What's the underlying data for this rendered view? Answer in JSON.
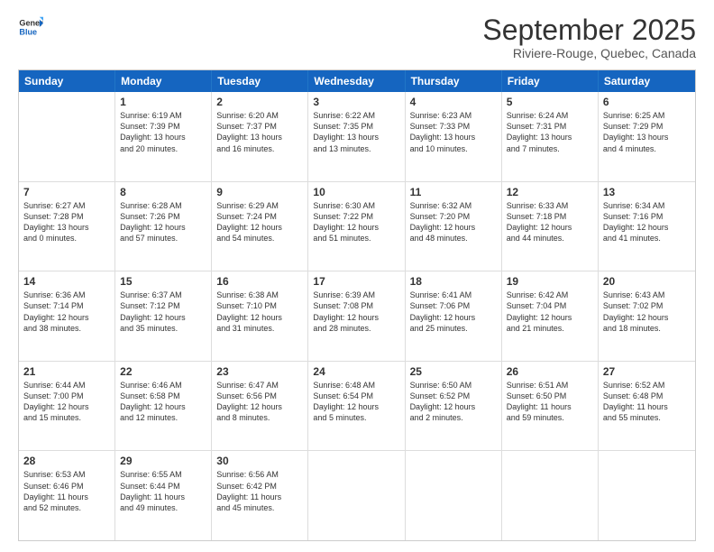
{
  "header": {
    "logo_general": "General",
    "logo_blue": "Blue",
    "month": "September 2025",
    "location": "Riviere-Rouge, Quebec, Canada"
  },
  "days_of_week": [
    "Sunday",
    "Monday",
    "Tuesday",
    "Wednesday",
    "Thursday",
    "Friday",
    "Saturday"
  ],
  "rows": [
    [
      {
        "day": "",
        "lines": []
      },
      {
        "day": "1",
        "lines": [
          "Sunrise: 6:19 AM",
          "Sunset: 7:39 PM",
          "Daylight: 13 hours",
          "and 20 minutes."
        ]
      },
      {
        "day": "2",
        "lines": [
          "Sunrise: 6:20 AM",
          "Sunset: 7:37 PM",
          "Daylight: 13 hours",
          "and 16 minutes."
        ]
      },
      {
        "day": "3",
        "lines": [
          "Sunrise: 6:22 AM",
          "Sunset: 7:35 PM",
          "Daylight: 13 hours",
          "and 13 minutes."
        ]
      },
      {
        "day": "4",
        "lines": [
          "Sunrise: 6:23 AM",
          "Sunset: 7:33 PM",
          "Daylight: 13 hours",
          "and 10 minutes."
        ]
      },
      {
        "day": "5",
        "lines": [
          "Sunrise: 6:24 AM",
          "Sunset: 7:31 PM",
          "Daylight: 13 hours",
          "and 7 minutes."
        ]
      },
      {
        "day": "6",
        "lines": [
          "Sunrise: 6:25 AM",
          "Sunset: 7:29 PM",
          "Daylight: 13 hours",
          "and 4 minutes."
        ]
      }
    ],
    [
      {
        "day": "7",
        "lines": [
          "Sunrise: 6:27 AM",
          "Sunset: 7:28 PM",
          "Daylight: 13 hours",
          "and 0 minutes."
        ]
      },
      {
        "day": "8",
        "lines": [
          "Sunrise: 6:28 AM",
          "Sunset: 7:26 PM",
          "Daylight: 12 hours",
          "and 57 minutes."
        ]
      },
      {
        "day": "9",
        "lines": [
          "Sunrise: 6:29 AM",
          "Sunset: 7:24 PM",
          "Daylight: 12 hours",
          "and 54 minutes."
        ]
      },
      {
        "day": "10",
        "lines": [
          "Sunrise: 6:30 AM",
          "Sunset: 7:22 PM",
          "Daylight: 12 hours",
          "and 51 minutes."
        ]
      },
      {
        "day": "11",
        "lines": [
          "Sunrise: 6:32 AM",
          "Sunset: 7:20 PM",
          "Daylight: 12 hours",
          "and 48 minutes."
        ]
      },
      {
        "day": "12",
        "lines": [
          "Sunrise: 6:33 AM",
          "Sunset: 7:18 PM",
          "Daylight: 12 hours",
          "and 44 minutes."
        ]
      },
      {
        "day": "13",
        "lines": [
          "Sunrise: 6:34 AM",
          "Sunset: 7:16 PM",
          "Daylight: 12 hours",
          "and 41 minutes."
        ]
      }
    ],
    [
      {
        "day": "14",
        "lines": [
          "Sunrise: 6:36 AM",
          "Sunset: 7:14 PM",
          "Daylight: 12 hours",
          "and 38 minutes."
        ]
      },
      {
        "day": "15",
        "lines": [
          "Sunrise: 6:37 AM",
          "Sunset: 7:12 PM",
          "Daylight: 12 hours",
          "and 35 minutes."
        ]
      },
      {
        "day": "16",
        "lines": [
          "Sunrise: 6:38 AM",
          "Sunset: 7:10 PM",
          "Daylight: 12 hours",
          "and 31 minutes."
        ]
      },
      {
        "day": "17",
        "lines": [
          "Sunrise: 6:39 AM",
          "Sunset: 7:08 PM",
          "Daylight: 12 hours",
          "and 28 minutes."
        ]
      },
      {
        "day": "18",
        "lines": [
          "Sunrise: 6:41 AM",
          "Sunset: 7:06 PM",
          "Daylight: 12 hours",
          "and 25 minutes."
        ]
      },
      {
        "day": "19",
        "lines": [
          "Sunrise: 6:42 AM",
          "Sunset: 7:04 PM",
          "Daylight: 12 hours",
          "and 21 minutes."
        ]
      },
      {
        "day": "20",
        "lines": [
          "Sunrise: 6:43 AM",
          "Sunset: 7:02 PM",
          "Daylight: 12 hours",
          "and 18 minutes."
        ]
      }
    ],
    [
      {
        "day": "21",
        "lines": [
          "Sunrise: 6:44 AM",
          "Sunset: 7:00 PM",
          "Daylight: 12 hours",
          "and 15 minutes."
        ]
      },
      {
        "day": "22",
        "lines": [
          "Sunrise: 6:46 AM",
          "Sunset: 6:58 PM",
          "Daylight: 12 hours",
          "and 12 minutes."
        ]
      },
      {
        "day": "23",
        "lines": [
          "Sunrise: 6:47 AM",
          "Sunset: 6:56 PM",
          "Daylight: 12 hours",
          "and 8 minutes."
        ]
      },
      {
        "day": "24",
        "lines": [
          "Sunrise: 6:48 AM",
          "Sunset: 6:54 PM",
          "Daylight: 12 hours",
          "and 5 minutes."
        ]
      },
      {
        "day": "25",
        "lines": [
          "Sunrise: 6:50 AM",
          "Sunset: 6:52 PM",
          "Daylight: 12 hours",
          "and 2 minutes."
        ]
      },
      {
        "day": "26",
        "lines": [
          "Sunrise: 6:51 AM",
          "Sunset: 6:50 PM",
          "Daylight: 11 hours",
          "and 59 minutes."
        ]
      },
      {
        "day": "27",
        "lines": [
          "Sunrise: 6:52 AM",
          "Sunset: 6:48 PM",
          "Daylight: 11 hours",
          "and 55 minutes."
        ]
      }
    ],
    [
      {
        "day": "28",
        "lines": [
          "Sunrise: 6:53 AM",
          "Sunset: 6:46 PM",
          "Daylight: 11 hours",
          "and 52 minutes."
        ]
      },
      {
        "day": "29",
        "lines": [
          "Sunrise: 6:55 AM",
          "Sunset: 6:44 PM",
          "Daylight: 11 hours",
          "and 49 minutes."
        ]
      },
      {
        "day": "30",
        "lines": [
          "Sunrise: 6:56 AM",
          "Sunset: 6:42 PM",
          "Daylight: 11 hours",
          "and 45 minutes."
        ]
      },
      {
        "day": "",
        "lines": []
      },
      {
        "day": "",
        "lines": []
      },
      {
        "day": "",
        "lines": []
      },
      {
        "day": "",
        "lines": []
      }
    ]
  ]
}
